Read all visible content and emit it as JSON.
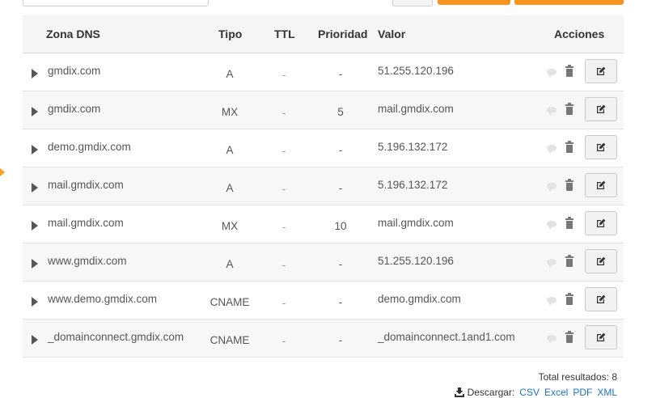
{
  "table": {
    "headers": {
      "zone": "Zona DNS",
      "type": "Tipo",
      "ttl": "TTL",
      "priority": "Prioridad",
      "value": "Valor",
      "actions": "Acciones"
    },
    "rows": [
      {
        "zone": "gmdix.com",
        "type": "A",
        "ttl": "-",
        "priority": "-",
        "value": "51.255.120.196"
      },
      {
        "zone": "gmdix.com",
        "type": "MX",
        "ttl": "-",
        "priority": "5",
        "value": "mail.gmdix.com"
      },
      {
        "zone": "demo.gmdix.com",
        "type": "A",
        "ttl": "-",
        "priority": "-",
        "value": "5.196.132.172"
      },
      {
        "zone": "mail.gmdix.com",
        "type": "A",
        "ttl": "-",
        "priority": "-",
        "value": "5.196.132.172"
      },
      {
        "zone": "mail.gmdix.com",
        "type": "MX",
        "ttl": "-",
        "priority": "10",
        "value": "mail.gmdix.com"
      },
      {
        "zone": "www.gmdix.com",
        "type": "A",
        "ttl": "-",
        "priority": "-",
        "value": "51.255.120.196"
      },
      {
        "zone": "www.demo.gmdix.com",
        "type": "CNAME",
        "ttl": "-",
        "priority": "-",
        "value": "demo.gmdix.com"
      },
      {
        "zone": "_domainconnect.gmdix.com",
        "type": "CNAME",
        "ttl": "-",
        "priority": "-",
        "value": "_domainconnect.1and1.com"
      }
    ]
  },
  "footer": {
    "total": "Total resultados: 8",
    "download_label": "Descargar:",
    "formats": [
      "CSV",
      "Excel",
      "PDF",
      "XML"
    ]
  },
  "colors": {
    "accent": "#f7941d",
    "link": "#1a73c9"
  },
  "icons": {
    "expand": "triangle-right",
    "comment": "speech-bubble",
    "delete": "trash-can",
    "edit": "pencil-square",
    "download": "download-tray"
  }
}
